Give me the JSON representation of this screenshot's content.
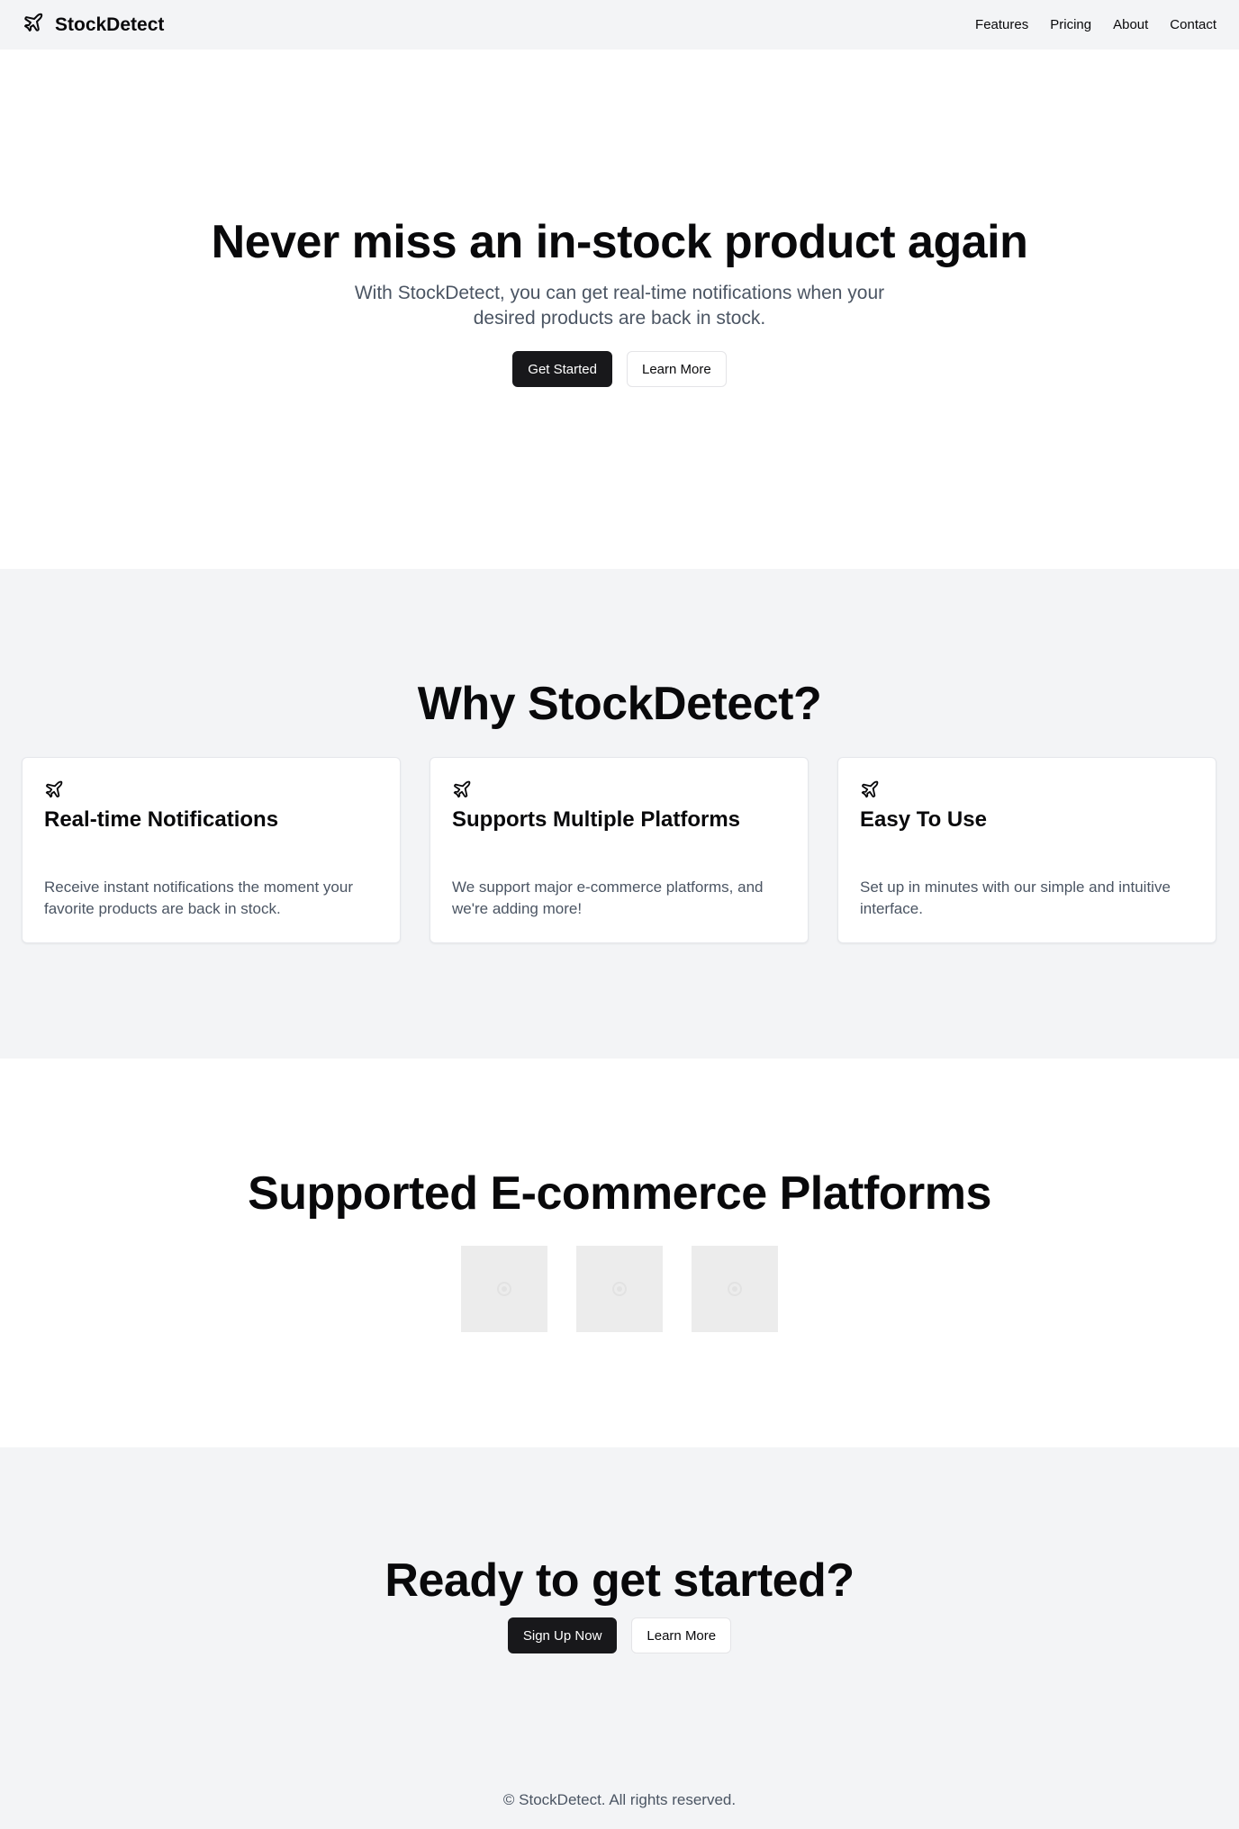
{
  "header": {
    "brand": "StockDetect",
    "nav": [
      "Features",
      "Pricing",
      "About",
      "Contact"
    ]
  },
  "hero": {
    "title": "Never miss an in-stock product again",
    "subtitle": "With StockDetect, you can get real-time notifications when your desired products are back in stock.",
    "primary_button": "Get Started",
    "secondary_button": "Learn More"
  },
  "features": {
    "title": "Why StockDetect?",
    "cards": [
      {
        "icon": "plane-icon",
        "title": "Real-time Notifications",
        "text": "Receive instant notifications the moment your favorite products are back in stock."
      },
      {
        "icon": "plane-icon",
        "title": "Supports Multiple Platforms",
        "text": "We support major e-commerce platforms, and we're adding more!"
      },
      {
        "icon": "plane-icon",
        "title": "Easy To Use",
        "text": "Set up in minutes with our simple and intuitive interface."
      }
    ]
  },
  "platforms": {
    "title": "Supported E-commerce Platforms",
    "logos": [
      "placeholder-image-icon",
      "placeholder-image-icon",
      "placeholder-image-icon"
    ]
  },
  "cta": {
    "title": "Ready to get started?",
    "primary_button": "Sign Up Now",
    "secondary_button": "Learn More"
  },
  "footer": {
    "text": "© StockDetect. All rights reserved."
  },
  "colors": {
    "primary": "#18181b",
    "section_gray": "#f3f4f6",
    "muted_text": "#4b5563"
  }
}
